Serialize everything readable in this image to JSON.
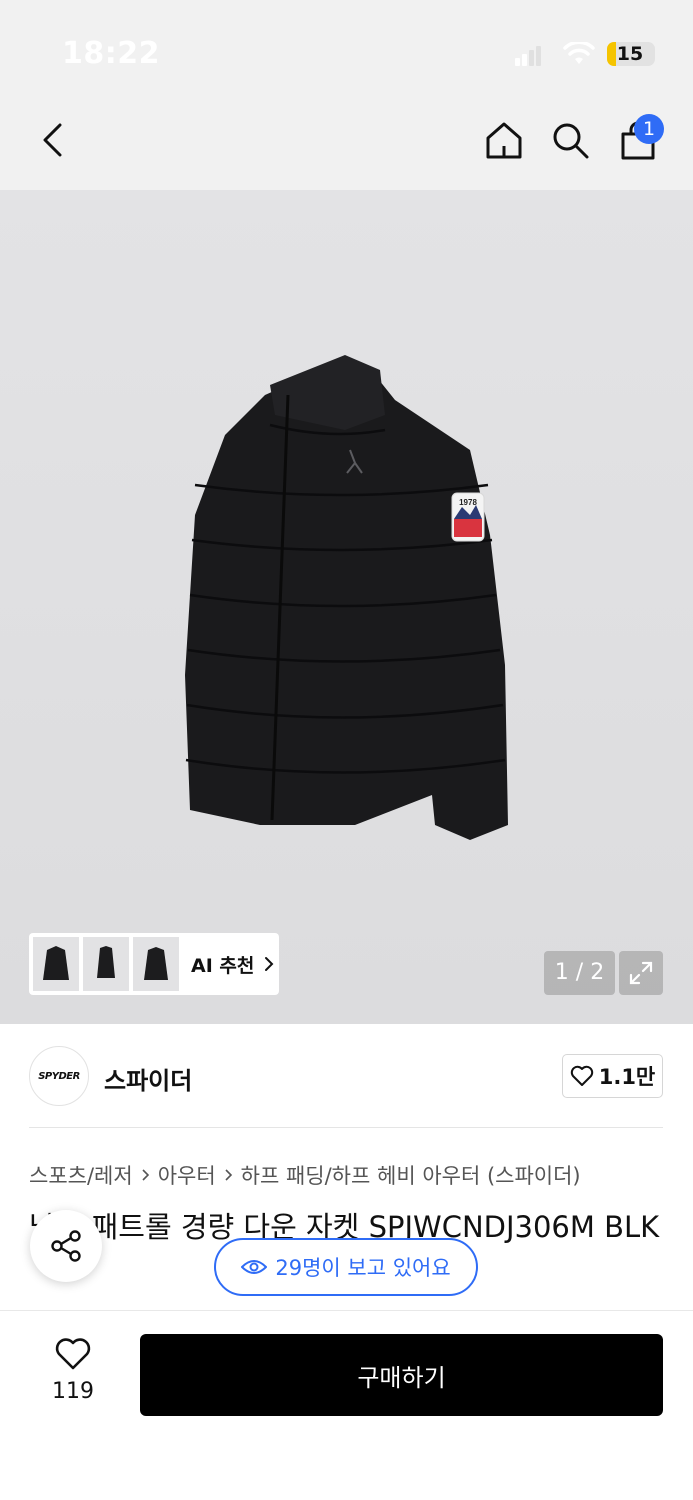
{
  "status_bar": {
    "time": "18:22",
    "battery": "15",
    "battery_color": "#f5c400"
  },
  "nav": {
    "cart_count": "1",
    "accent": "#2f6cf6",
    "icons": [
      "back-icon",
      "home-icon",
      "search-icon",
      "cart-icon"
    ]
  },
  "gallery": {
    "thumb_label": "AI 추천",
    "page_counter": "1 / 2",
    "patch_year": "1978"
  },
  "brand": {
    "logo_text": "SPYDER",
    "name": "스파이더",
    "likes": "1.1만"
  },
  "breadcrumb": [
    "스포츠/레저",
    "아우터",
    "하프 패딩/하프 헤비 아우터 (스파이더)"
  ],
  "product": {
    "title": "남성 패트롤 경량 다운 자켓 SPJWCNDJ306M BLK"
  },
  "viewers": {
    "text": "29명이 보고 있어요"
  },
  "bottom": {
    "wish_count": "119",
    "buy_label": "구매하기"
  }
}
